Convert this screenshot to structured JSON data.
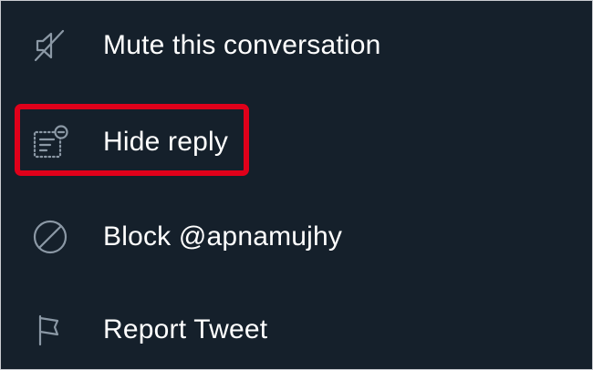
{
  "menu": {
    "items": [
      {
        "label": "Mute this conversation",
        "icon": "mute-icon"
      },
      {
        "label": "Hide reply",
        "icon": "hide-reply-icon"
      },
      {
        "label": "Block @apnamujhy",
        "icon": "block-icon"
      },
      {
        "label": "Report Tweet",
        "icon": "flag-icon"
      }
    ]
  },
  "colors": {
    "background": "#15202b",
    "text": "#ffffff",
    "icon": "#8b98a5",
    "highlight": "#e0001a"
  }
}
